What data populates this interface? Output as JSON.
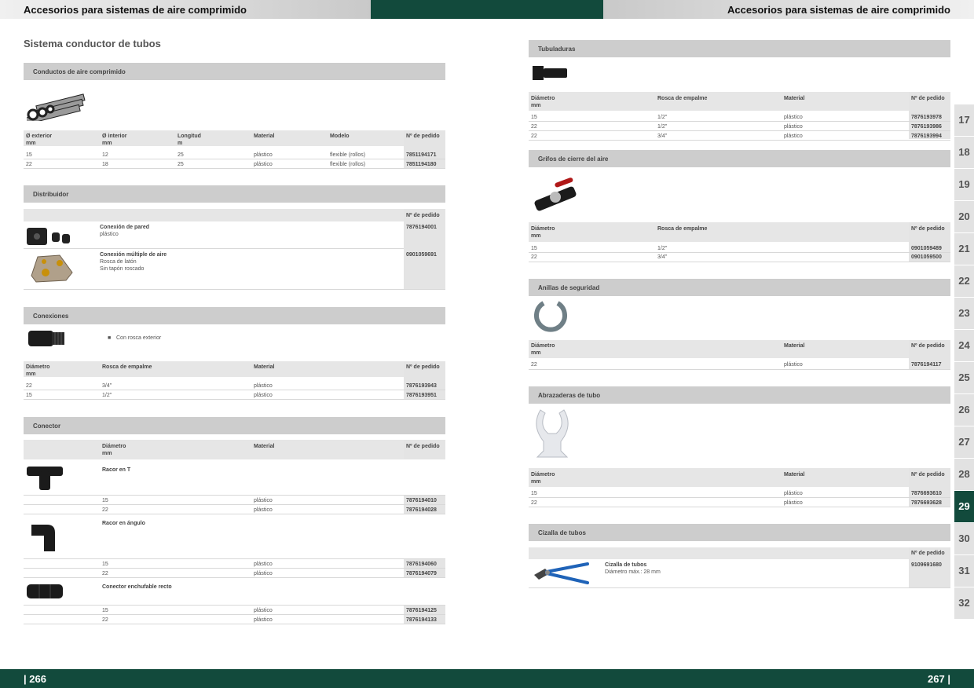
{
  "header": {
    "left": "Accesorios para sistemas de aire comprimido",
    "right": "Accesorios para sistemas de aire comprimido"
  },
  "footer": {
    "left": "| 266",
    "right": "267 |"
  },
  "section_title": "Sistema conductor de tubos",
  "conductos": {
    "title": "Conductos de aire comprimido",
    "h1": "Ø exterior",
    "h1u": "mm",
    "h2": "Ø interior",
    "h2u": "mm",
    "h3": "Longitud",
    "h3u": "m",
    "h4": "Material",
    "h5": "Modelo",
    "h6": "Nº de pedido",
    "rows": [
      {
        "a": "15",
        "b": "12",
        "c": "25",
        "d": "plástico",
        "e": "flexible (rollos)",
        "f": "7851194171"
      },
      {
        "a": "22",
        "b": "18",
        "c": "25",
        "d": "plástico",
        "e": "flexible (rollos)",
        "f": "7851194180"
      }
    ]
  },
  "distribuidor": {
    "title": "Distribuidor",
    "h": "Nº de pedido",
    "i1": {
      "name": "Conexión de pared",
      "d1": "plástico",
      "f": "7876194001"
    },
    "i2": {
      "name": "Conexión múltiple de aire",
      "d1": "Rosca de latón",
      "d2": "Sin tapón roscado",
      "f": "0901059691"
    }
  },
  "conexiones": {
    "title": "Conexiones",
    "bullet": "Con rosca exterior",
    "h1": "Diámetro",
    "h1u": "mm",
    "h2": "Rosca de empalme",
    "h3": "Material",
    "h4": "Nº de pedido",
    "rows": [
      {
        "a": "22",
        "b": "3/4\"",
        "c": "plástico",
        "f": "7876193943"
      },
      {
        "a": "15",
        "b": "1/2\"",
        "c": "plástico",
        "f": "7876193951"
      }
    ]
  },
  "conector": {
    "title": "Conector",
    "h1": "Diámetro",
    "h1u": "mm",
    "h2": "Material",
    "h3": "Nº de pedido",
    "g1": {
      "name": "Racor en T",
      "rows": [
        {
          "a": "15",
          "c": "plástico",
          "f": "7876194010"
        },
        {
          "a": "22",
          "c": "plástico",
          "f": "7876194028"
        }
      ]
    },
    "g2": {
      "name": "Racor en ángulo",
      "rows": [
        {
          "a": "15",
          "c": "plástico",
          "f": "7876194060"
        },
        {
          "a": "22",
          "c": "plástico",
          "f": "7876194079"
        }
      ]
    },
    "g3": {
      "name": "Conector enchufable recto",
      "rows": [
        {
          "a": "15",
          "c": "plástico",
          "f": "7876194125"
        },
        {
          "a": "22",
          "c": "plástico",
          "f": "7876194133"
        }
      ]
    }
  },
  "tubuladuras": {
    "title": "Tubuladuras",
    "h1": "Diámetro",
    "h1u": "mm",
    "h2": "Rosca de empalme",
    "h3": "Material",
    "h4": "Nº de pedido",
    "rows": [
      {
        "a": "15",
        "b": "1/2\"",
        "c": "plástico",
        "f": "7876193978"
      },
      {
        "a": "22",
        "b": "1/2\"",
        "c": "plástico",
        "f": "7876193986"
      },
      {
        "a": "22",
        "b": "3/4\"",
        "c": "plástico",
        "f": "7876193994"
      }
    ]
  },
  "grifos": {
    "title": "Grifos de cierre del aire",
    "h1": "Diámetro",
    "h1u": "mm",
    "h2": "Rosca de empalme",
    "h4": "Nº de pedido",
    "rows": [
      {
        "a": "15",
        "b": "1/2\"",
        "f": "0901059489"
      },
      {
        "a": "22",
        "b": "3/4\"",
        "f": "0901059500"
      }
    ]
  },
  "anillas": {
    "title": "Anillas de seguridad",
    "h1": "Diámetro",
    "h1u": "mm",
    "h3": "Material",
    "h4": "Nº de pedido",
    "rows": [
      {
        "a": "22",
        "c": "plástico",
        "f": "7876194117"
      }
    ]
  },
  "abrazaderas": {
    "title": "Abrazaderas de tubo",
    "h1": "Diámetro",
    "h1u": "mm",
    "h3": "Material",
    "h4": "Nº de pedido",
    "rows": [
      {
        "a": "15",
        "c": "plástico",
        "f": "7876693610"
      },
      {
        "a": "22",
        "c": "plástico",
        "f": "7876693628"
      }
    ]
  },
  "cizalla": {
    "title": "Cizalla de tubos",
    "h": "Nº de pedido",
    "name": "Cizalla de tubos",
    "d1": "Diámetro máx.: 28 mm",
    "f": "9109691680"
  },
  "tabs": [
    "17",
    "18",
    "19",
    "20",
    "21",
    "22",
    "23",
    "24",
    "25",
    "26",
    "27",
    "28",
    "29",
    "30",
    "31",
    "32"
  ],
  "active_tab": "29"
}
